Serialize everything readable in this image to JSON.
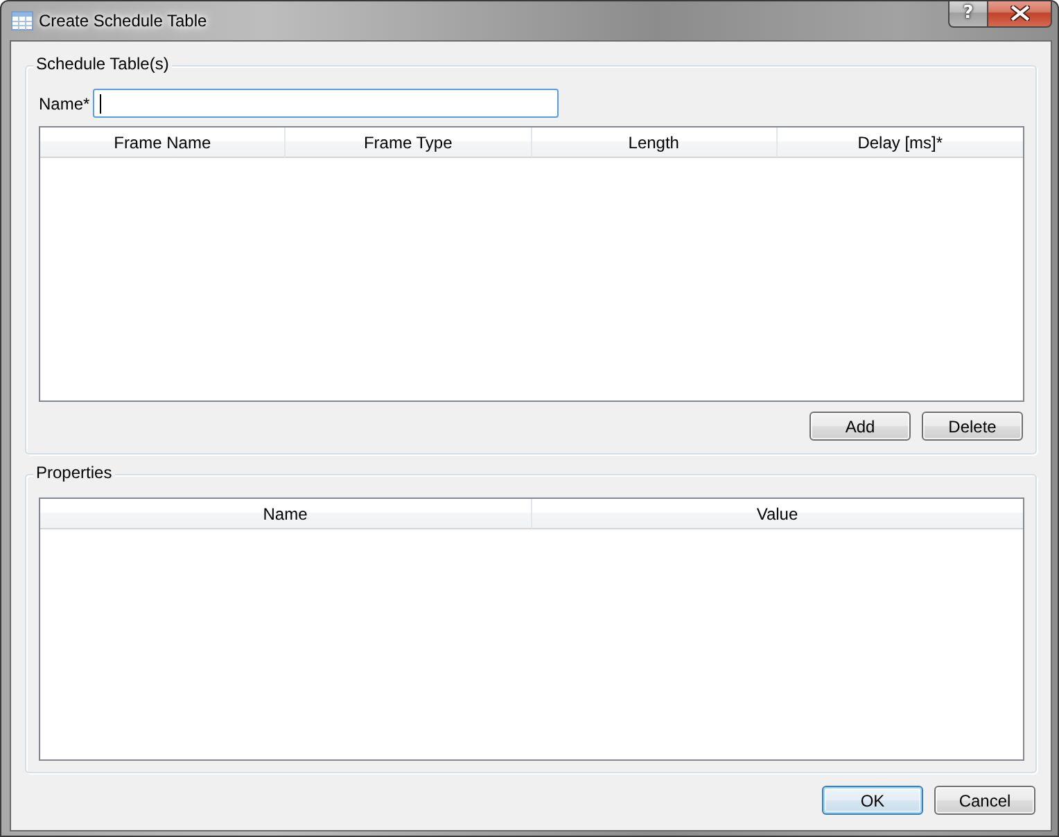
{
  "window": {
    "title": "Create Schedule Table",
    "controls": [
      {
        "kind": "help",
        "glyph": "?"
      },
      {
        "kind": "close"
      }
    ]
  },
  "schedule_group": {
    "title": "Schedule Table(s)",
    "name_field": {
      "label": "Name*",
      "focused": true
    },
    "table": {
      "columns": [
        "Frame Name",
        "Frame Type",
        "Length",
        "Delay [ms]*"
      ]
    },
    "buttons": [
      {
        "label": "Add"
      },
      {
        "label": "Delete"
      }
    ]
  },
  "properties_group": {
    "title": "Properties",
    "table": {
      "columns": [
        "Name",
        "Value"
      ]
    }
  },
  "dialog_buttons": [
    {
      "label": "OK",
      "default": true
    },
    {
      "label": "Cancel",
      "default": false
    }
  ]
}
